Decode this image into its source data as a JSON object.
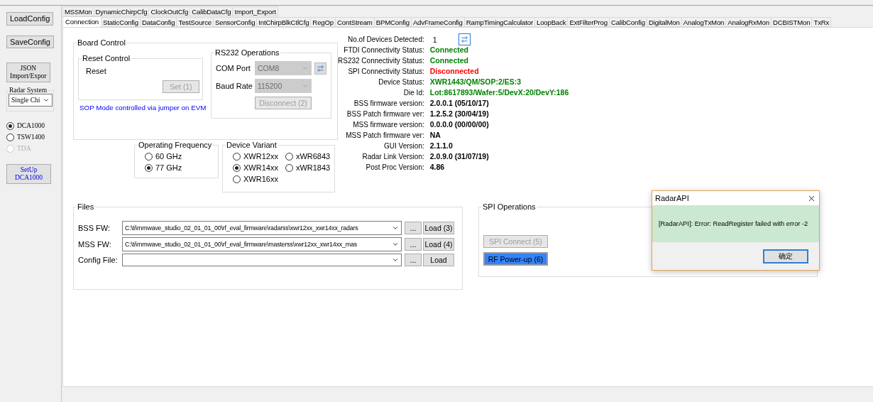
{
  "sidebar": {
    "buttons": [
      {
        "label": "LoadConfig"
      },
      {
        "label": "SaveConfig"
      },
      {
        "label": "JSON\nImport/Expor"
      }
    ],
    "radar_system": {
      "title": "Radar System",
      "value": "Single Chi"
    },
    "capture_options": [
      {
        "label": "DCA1000",
        "selected": true,
        "disabled": false
      },
      {
        "label": "TSW1400",
        "selected": false,
        "disabled": false
      },
      {
        "label": "TDA",
        "selected": false,
        "disabled": true
      }
    ],
    "setup_button": {
      "label": "SetUp\nDCA1000"
    }
  },
  "tabs_row_1": [
    {
      "label": "MSSMon",
      "selected": false
    },
    {
      "label": "DynamicChirpCfg",
      "selected": false
    },
    {
      "label": "ClockOutCfg",
      "selected": false
    },
    {
      "label": "CalibDataCfg",
      "selected": false
    },
    {
      "label": "Import_Export",
      "selected": false
    }
  ],
  "tabs_row_2": [
    {
      "label": "Connection",
      "selected": true
    },
    {
      "label": "StaticConfig",
      "selected": false
    },
    {
      "label": "DataConfig",
      "selected": false
    },
    {
      "label": "TestSource",
      "selected": false
    },
    {
      "label": "SensorConfig",
      "selected": false
    },
    {
      "label": "IntChirpBlkCtlCfg",
      "selected": false
    },
    {
      "label": "RegOp",
      "selected": false
    },
    {
      "label": "ContStream",
      "selected": false
    },
    {
      "label": "BPMConfig",
      "selected": false
    },
    {
      "label": "AdvFrameConfig",
      "selected": false
    },
    {
      "label": "RampTimingCalculator",
      "selected": false
    },
    {
      "label": "LoopBack",
      "selected": false
    },
    {
      "label": "ExtFilterProg",
      "selected": false
    },
    {
      "label": "CalibConfig",
      "selected": false
    },
    {
      "label": "DigitalMon",
      "selected": false
    },
    {
      "label": "AnalogTxMon",
      "selected": false
    },
    {
      "label": "AnalogRxMon",
      "selected": false
    },
    {
      "label": "DCBISTMon",
      "selected": false
    },
    {
      "label": "TxRx",
      "selected": false
    }
  ],
  "board_control": {
    "title": "Board Control",
    "reset_control": {
      "title": "Reset Control",
      "label": "Reset",
      "button": {
        "label": "Set (1)",
        "disabled": true
      }
    },
    "sop_note": "SOP Mode controlled via jumper on EVM",
    "rs232": {
      "title": "RS232 Operations",
      "fields": [
        {
          "label": "COM Port",
          "value": "COM8",
          "disabled": true
        },
        {
          "label": "Baud Rate",
          "value": "115200",
          "disabled": true
        }
      ],
      "button": {
        "label": "Disconnect (2)",
        "disabled": true
      }
    }
  },
  "operating_frequency": {
    "title": "Operating Frequency",
    "options": [
      {
        "label": "60 GHz",
        "selected": false
      },
      {
        "label": "77 GHz",
        "selected": true
      }
    ]
  },
  "device_variant": {
    "title": "Device Variant",
    "options": [
      {
        "label": "XWR12xx",
        "selected": false
      },
      {
        "label": "xWR6843",
        "selected": false
      },
      {
        "label": "XWR14xx",
        "selected": true
      },
      {
        "label": "xWR1843",
        "selected": false
      },
      {
        "label": "XWR16xx",
        "selected": false
      }
    ]
  },
  "device_info": {
    "devices_detected": {
      "label": "No.of Devices Detected:",
      "value": "1"
    },
    "rows": [
      {
        "label": "FTDI Connectivity Status:",
        "value": "Connected",
        "kind": "ok"
      },
      {
        "label": "RS232 Connectivity Status:",
        "value": "Connected",
        "kind": "ok"
      },
      {
        "label": "SPI Connectivity Status:",
        "value": "Disconnected",
        "kind": "error"
      },
      {
        "label": "Device Status:",
        "value": "XWR1443/QM/SOP:2/ES:3",
        "kind": "ok"
      },
      {
        "label": "Die Id:",
        "value": "Lot:8617893/Wafer:5/DevX:20/DevY:186",
        "kind": "ok"
      },
      {
        "label": "BSS firmware version:",
        "value": "2.0.0.1 (05/10/17)",
        "kind": "plain"
      },
      {
        "label": "BSS Patch firmware ver:",
        "value": "1.2.5.2 (30/04/19)",
        "kind": "plain"
      },
      {
        "label": "MSS firmware version:",
        "value": "0.0.0.0 (00/00/00)",
        "kind": "plain"
      },
      {
        "label": "MSS Patch firmware ver:",
        "value": "NA",
        "kind": "plain"
      },
      {
        "label": "GUI Version:",
        "value": "2.1.1.0",
        "kind": "plain"
      },
      {
        "label": "Radar Link Version:",
        "value": "2.0.9.0 (31/07/19)",
        "kind": "plain"
      },
      {
        "label": "Post Proc Version:",
        "value": "4.86",
        "kind": "plain"
      }
    ]
  },
  "files": {
    "title": "Files",
    "rows": [
      {
        "label": "BSS FW:",
        "value": "C:\\ti\\mmwave_studio_02_01_01_00\\rf_eval_firmware\\radarss\\xwr12xx_xwr14xx_radars",
        "browse": "...",
        "load": "Load (3)"
      },
      {
        "label": "MSS FW:",
        "value": "C:\\ti\\mmwave_studio_02_01_01_00\\rf_eval_firmware\\masterss\\xwr12xx_xwr14xx_mas",
        "browse": "...",
        "load": "Load (4)"
      },
      {
        "label": "Config File:",
        "value": "",
        "browse": "...",
        "load": "Load"
      }
    ]
  },
  "spi_operations": {
    "title": "SPI Operations",
    "buttons": [
      {
        "label": "SPI Connect (5)",
        "disabled": true,
        "focused": false
      },
      {
        "label": "RF Power-up (6)",
        "disabled": false,
        "focused": true
      }
    ]
  },
  "dialog": {
    "title": "RadarAPI",
    "message": "[RadarAPI]: Error: ReadRegister failed with error -2",
    "button": "确定"
  }
}
